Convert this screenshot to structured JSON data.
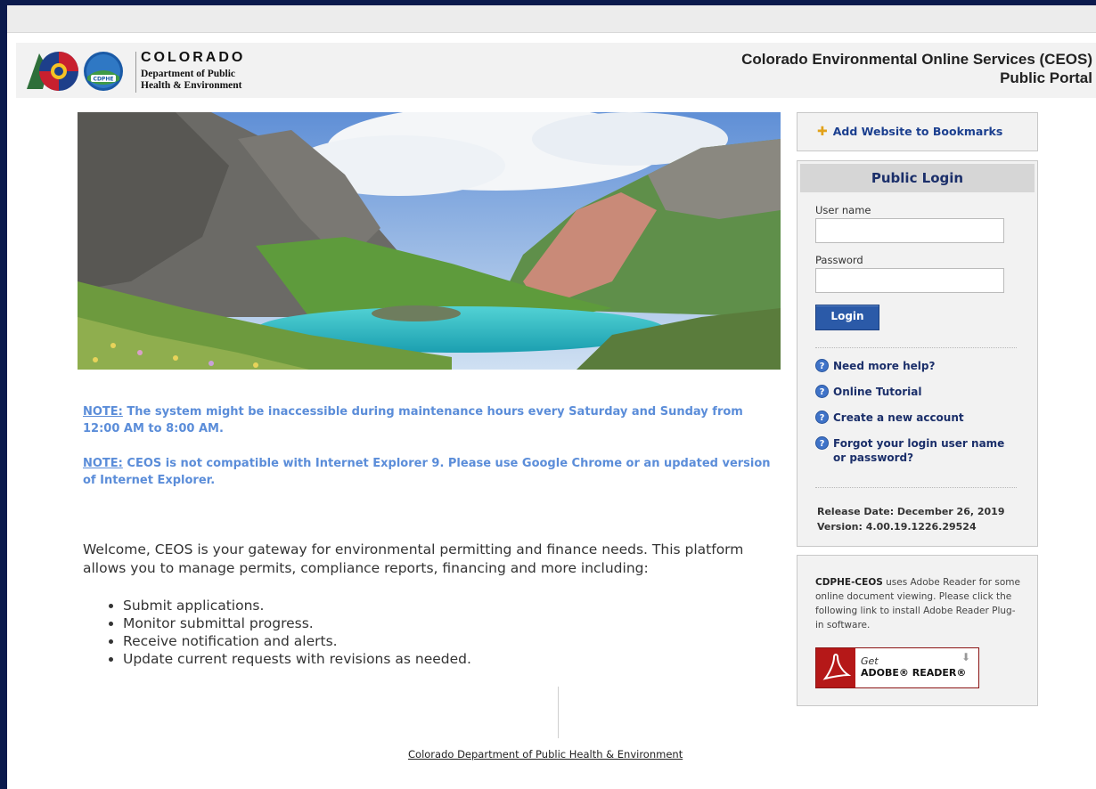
{
  "header": {
    "state_name": "COLORADO",
    "dept_line1": "Department of Public",
    "dept_line2": "Health & Environment",
    "logo_badge_text": "CDPHE",
    "portal_title_line1": "Colorado Environmental Online Services (CEOS)",
    "portal_title_line2": "Public Portal"
  },
  "notices": [
    {
      "label": "NOTE:",
      "text": "The system might be inaccessible during maintenance hours every Saturday and Sunday from 12:00 AM to 8:00 AM."
    },
    {
      "label": "NOTE:",
      "text": "CEOS is not compatible with Internet Explorer 9. Please use Google Chrome or an updated version of Internet Explorer."
    }
  ],
  "welcome": {
    "text": "Welcome, CEOS is your gateway for environmental permitting and finance needs. This platform allows you to manage permits, compliance reports, financing and more including:",
    "bullets": [
      "Submit applications.",
      "Monitor submittal progress.",
      "Receive notification and alerts.",
      "Update current requests with revisions as needed."
    ]
  },
  "footer": {
    "link": "Colorado Department of Public Health & Environment"
  },
  "sidebar": {
    "bookmark": "Add Website to Bookmarks",
    "login": {
      "title": "Public Login",
      "username_label": "User name",
      "username_value": "",
      "password_label": "Password",
      "password_value": "",
      "button": "Login"
    },
    "help_links": [
      {
        "icon": "question-circle-icon",
        "label": "Need more help?"
      },
      {
        "icon": "question-circle-icon",
        "label": "Online Tutorial"
      },
      {
        "icon": "question-circle-icon",
        "label": "Create a new account"
      },
      {
        "icon": "question-circle-icon",
        "label": "Forgot your login user name or password?"
      }
    ],
    "release_date": "Release Date:  December 26, 2019",
    "version": "Version:  4.00.19.1226.29524",
    "adobe": {
      "brand": "CDPHE-CEOS",
      "text": " uses Adobe Reader for some online document viewing. Please click the following link to install Adobe Reader Plug-in software.",
      "badge_get": "Get",
      "badge_product": "ADOBE® READER®"
    }
  },
  "colors": {
    "outer_background": "#0b1a4d",
    "note_text": "#5b8dd9",
    "link_navy": "#1b2f6a",
    "login_button": "#2b5aa8",
    "adobe_red": "#b51818"
  }
}
